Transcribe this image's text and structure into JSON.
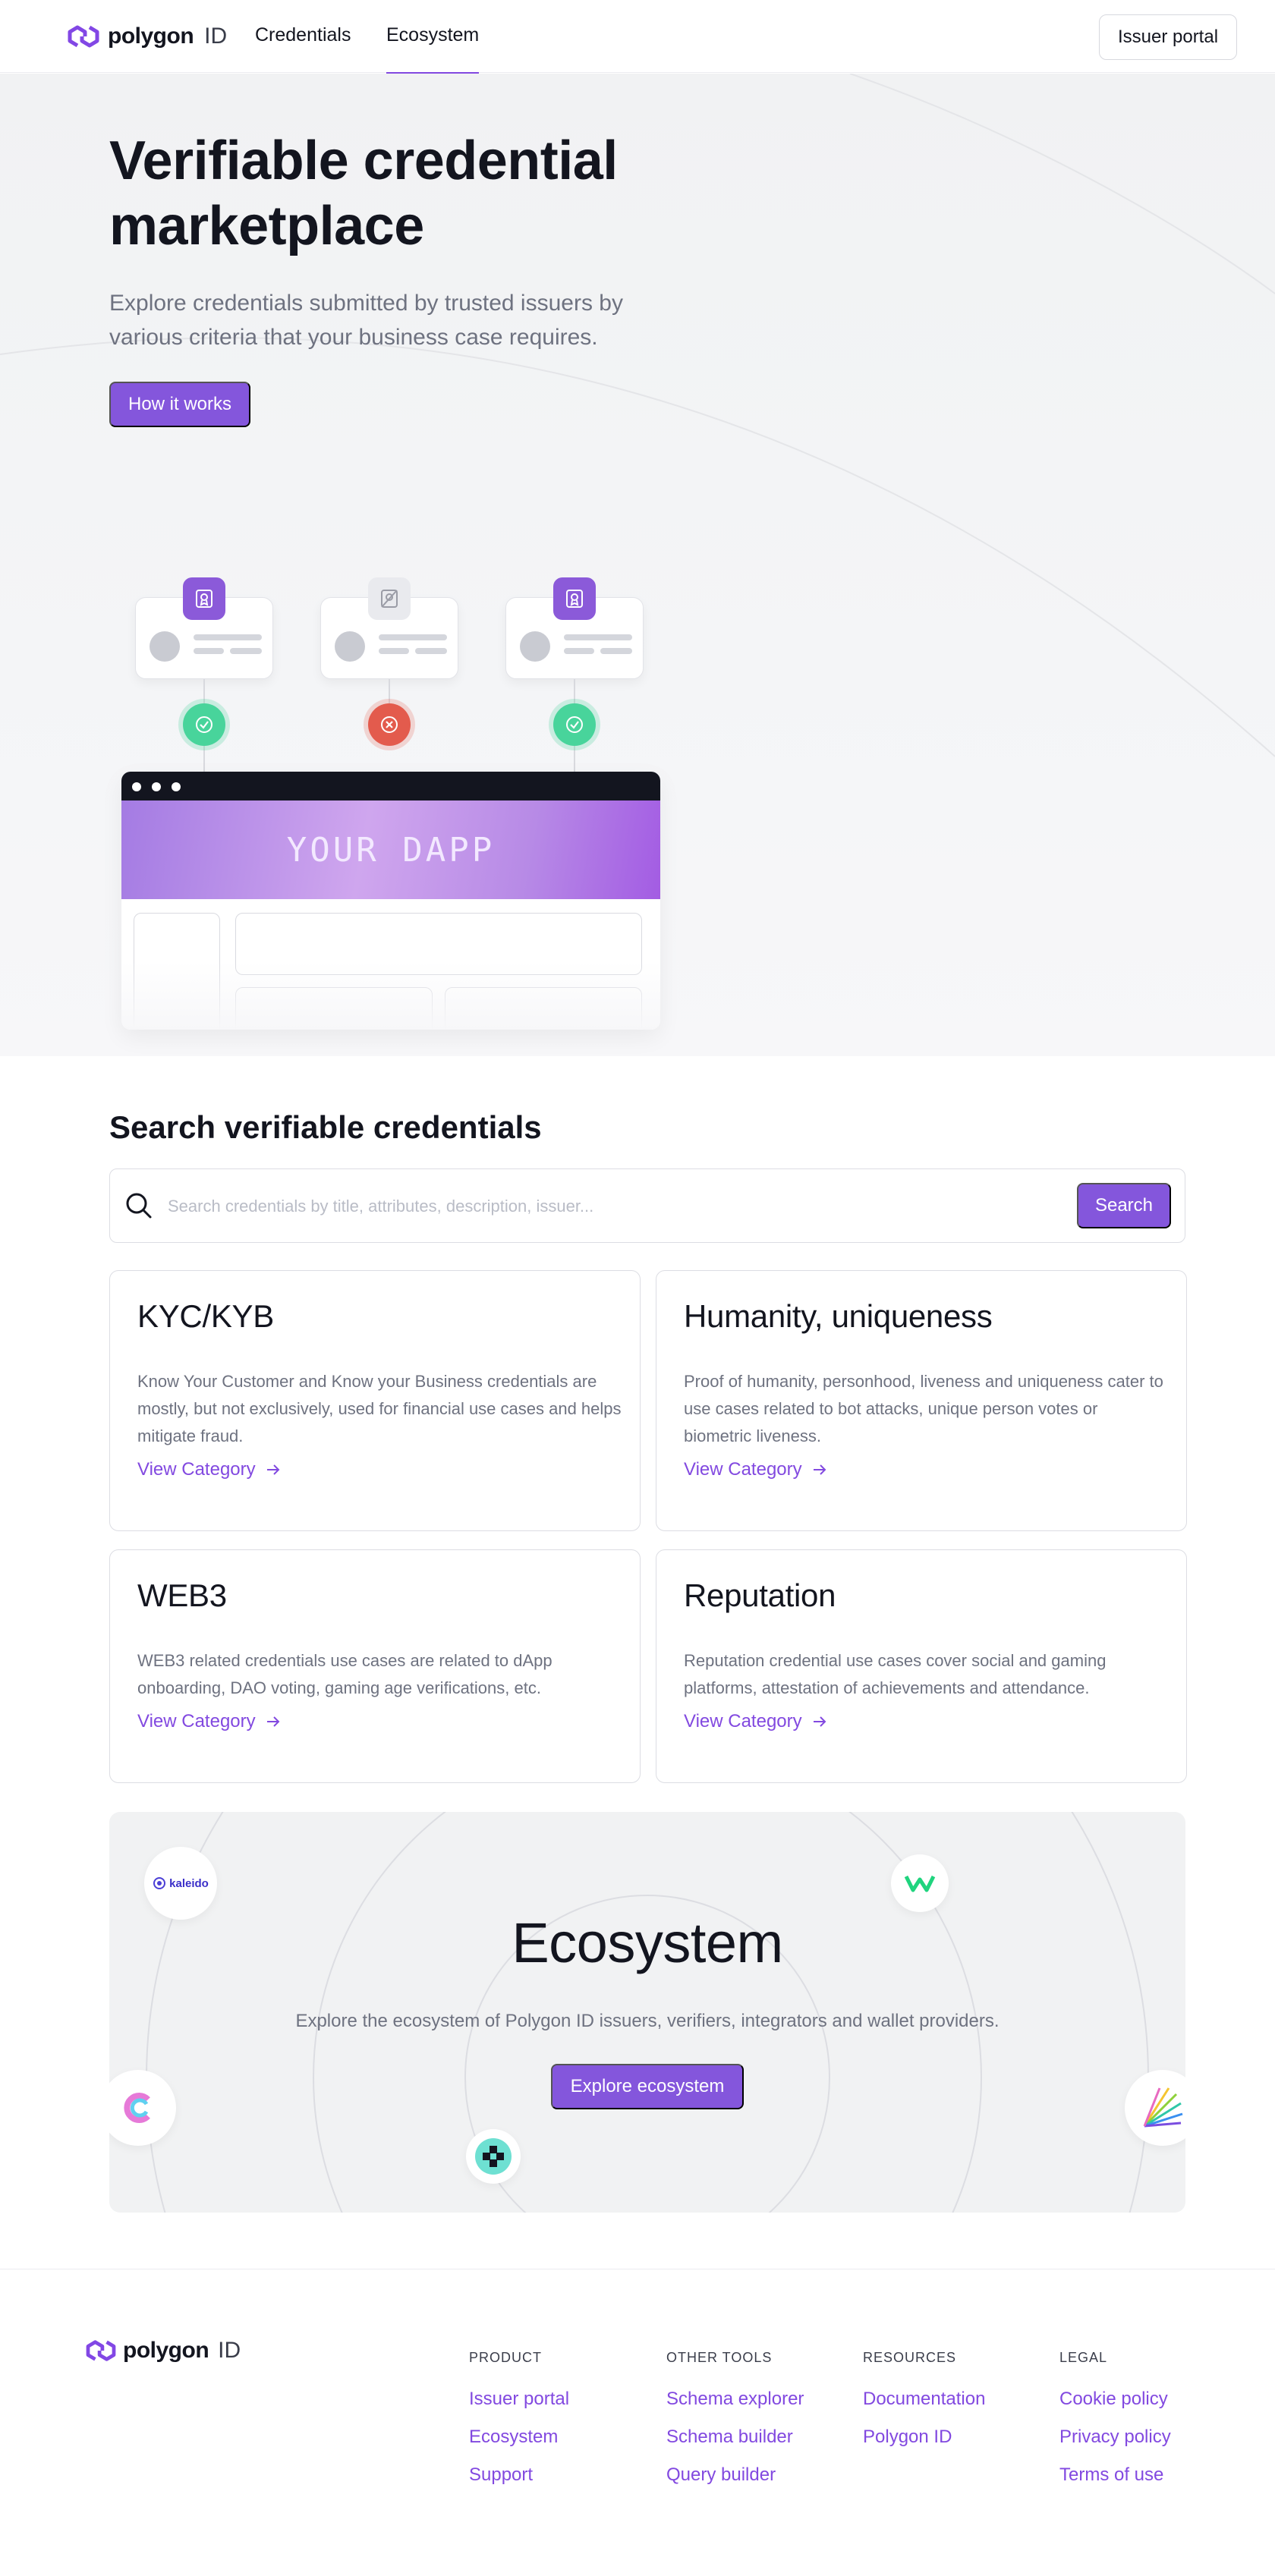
{
  "nav": {
    "logo_word": "polygon",
    "logo_id": "ID",
    "links": [
      "Credentials",
      "Ecosystem"
    ],
    "active": "Ecosystem",
    "issuer_portal": "Issuer portal"
  },
  "hero": {
    "title": "Verifiable credential marketplace",
    "subtitle": "Explore credentials submitted by trusted issuers by various criteria that your business case requires.",
    "cta": "How it works",
    "illustration": {
      "dapp_label": "YOUR DAPP"
    }
  },
  "search": {
    "title": "Search verifiable credentials",
    "placeholder": "Search credentials by title, attributes, description, issuer...",
    "button": "Search",
    "categories": [
      {
        "title": "KYC/KYB",
        "description": "Know Your Customer and Know your Business credentials are mostly, but not exclusively, used for financial use cases and helps mitigate fraud.",
        "link": "View Category"
      },
      {
        "title": "Humanity, uniqueness",
        "description": "Proof of humanity, personhood, liveness and uniqueness cater to use cases related to bot attacks, unique person votes or biometric liveness.",
        "link": "View Category"
      },
      {
        "title": "WEB3",
        "description": "WEB3 related credentials use cases are related to dApp onboarding, DAO voting, gaming age verifications, etc.",
        "link": "View Category"
      },
      {
        "title": "Reputation",
        "description": "Reputation credential use cases cover social and gaming platforms, attestation of achievements and attendance.",
        "link": "View Category"
      }
    ]
  },
  "ecosystem": {
    "title": "Ecosystem",
    "description": "Explore the ecosystem of Polygon ID issuers, verifiers, integrators and wallet providers.",
    "button": "Explore ecosystem",
    "partner_logo_text": "kaleido"
  },
  "footer": {
    "logo_word": "polygon",
    "logo_id": "ID",
    "columns": [
      {
        "heading": "PRODUCT",
        "links": [
          "Issuer portal",
          "Ecosystem",
          "Support"
        ]
      },
      {
        "heading": "OTHER TOOLS",
        "links": [
          "Schema explorer",
          "Schema builder",
          "Query builder"
        ]
      },
      {
        "heading": "RESOURCES",
        "links": [
          "Documentation",
          "Polygon ID"
        ]
      },
      {
        "heading": "LEGAL",
        "links": [
          "Cookie policy",
          "Privacy policy",
          "Terms of use"
        ]
      }
    ]
  },
  "colors": {
    "accent": "#8456dc",
    "link": "#8249e0",
    "text": "#13151f",
    "muted": "#6e7280",
    "success": "#48d49b",
    "error": "#e35b4d"
  }
}
